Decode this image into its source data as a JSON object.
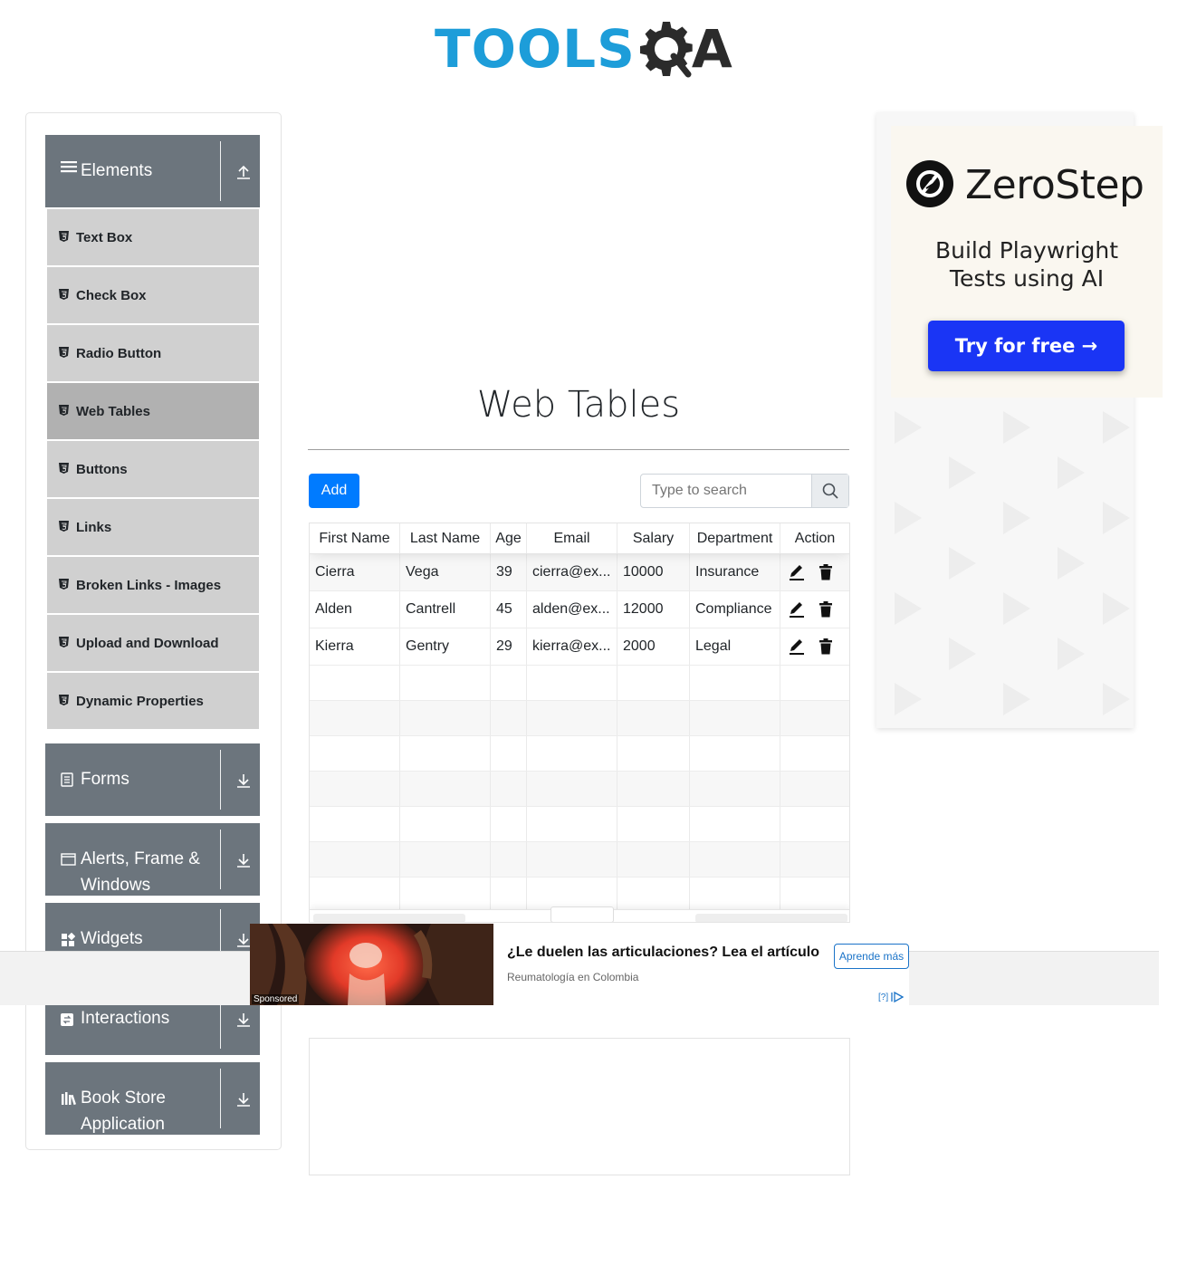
{
  "logo": {
    "part1": "TOOLS",
    "part2": "A"
  },
  "sidebar": {
    "elements_header": "Elements",
    "items": [
      {
        "label": "Text Box"
      },
      {
        "label": "Check Box"
      },
      {
        "label": "Radio Button"
      },
      {
        "label": "Web Tables",
        "active": true
      },
      {
        "label": "Buttons"
      },
      {
        "label": "Links"
      },
      {
        "label": "Broken Links - Images"
      },
      {
        "label": "Upload and Download"
      },
      {
        "label": "Dynamic Properties"
      }
    ],
    "groups": [
      {
        "label": "Forms",
        "icon": "form-icon"
      },
      {
        "label": "Alerts, Frame & Windows",
        "icon": "window-icon"
      },
      {
        "label": "Widgets",
        "icon": "widgets-icon"
      },
      {
        "label": "Interactions",
        "icon": "interactions-icon"
      },
      {
        "label": "Book Store Application",
        "icon": "books-icon"
      }
    ]
  },
  "main": {
    "title": "Web Tables",
    "add_label": "Add",
    "search_placeholder": "Type to search",
    "table": {
      "headers": [
        "First Name",
        "Last Name",
        "Age",
        "Email",
        "Salary",
        "Department",
        "Action"
      ],
      "rows": [
        [
          "Cierra",
          "Vega",
          "39",
          "cierra@ex...",
          "10000",
          "Insurance"
        ],
        [
          "Alden",
          "Cantrell",
          "45",
          "alden@ex...",
          "12000",
          "Compliance"
        ],
        [
          "Kierra",
          "Gentry",
          "29",
          "kierra@ex...",
          "2000",
          "Legal"
        ]
      ]
    }
  },
  "right_ad": {
    "brand": "ZeroStep",
    "tagline_line1": "Build Playwright",
    "tagline_line2": "Tests using AI",
    "cta": "Try for free →",
    "button_color": "#1a35f5"
  },
  "sponsored": {
    "label": "Sponsored",
    "title": "¿Le duelen las articulaciones? Lea el artículo",
    "source": "Reumatología en Colombia",
    "cta": "Aprende más",
    "adchoice": "[?]"
  },
  "colors": {
    "accent": "#007bff",
    "sidebar_header": "#6c757d",
    "menu_item": "#d0d0d0",
    "menu_active": "#b1b1b1",
    "logo_blue": "#1d9dd9"
  }
}
